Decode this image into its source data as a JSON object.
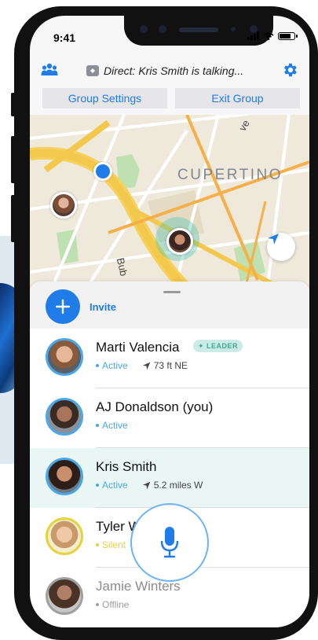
{
  "status_bar": {
    "time": "9:41"
  },
  "header": {
    "direct_text": "Direct: Kris Smith is talking...",
    "group_settings_label": "Group Settings",
    "exit_group_label": "Exit Group"
  },
  "map": {
    "city_label": "CUPERTINO",
    "road_label_1": "Bub",
    "road_label_2": "ve"
  },
  "sheet": {
    "invite_label": "Invite"
  },
  "members": [
    {
      "name": "Marti Valencia",
      "badge": "✦ LEADER",
      "status": "Active",
      "distance": "73 ft NE"
    },
    {
      "name": "AJ Donaldson  (you)",
      "status": "Active"
    },
    {
      "name": "Kris Smith",
      "status": "Active",
      "distance": "5.2 miles W"
    },
    {
      "name": "Tyler W",
      "status": "Silent"
    },
    {
      "name": "Jamie Winters",
      "status": "Offline"
    }
  ],
  "colors": {
    "accent": "#1f7ce8",
    "active": "#4aa8e8",
    "silent": "#e6d23a",
    "offline": "#a0a0a0",
    "leader_bg": "#cdebe6",
    "leader_text": "#3aa896",
    "highlight_row": "#eaf6f4"
  },
  "icons": {
    "group": "group-icon",
    "direct": "direct-talk-icon",
    "settings": "gear-icon",
    "invite": "plus-icon",
    "locate": "location-arrow-icon",
    "mic": "microphone-icon"
  }
}
